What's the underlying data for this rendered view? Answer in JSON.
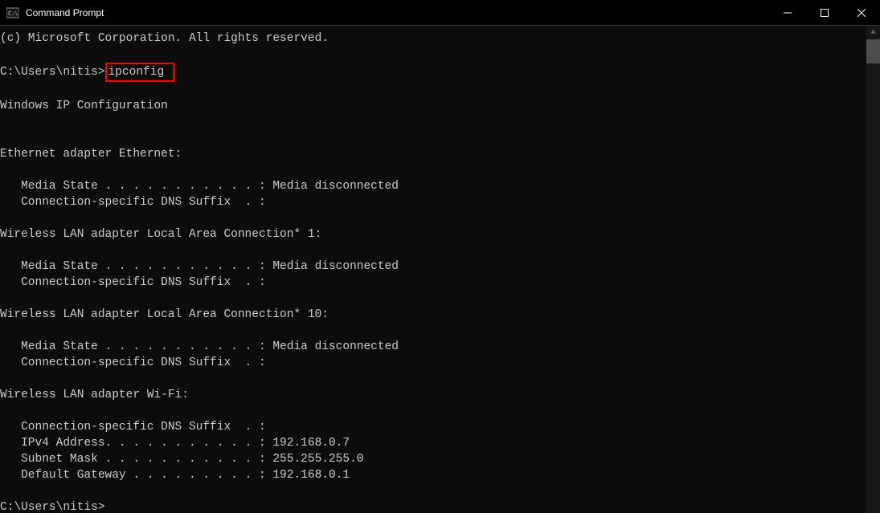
{
  "window": {
    "title": "Command Prompt"
  },
  "terminal": {
    "copyright": "(c) Microsoft Corporation. All rights reserved.",
    "prompt1_path": "C:\\Users\\nitis>",
    "command": "ipconfig",
    "heading": "Windows IP Configuration",
    "adapters": [
      {
        "name": "Ethernet adapter Ethernet:",
        "lines": [
          "   Media State . . . . . . . . . . . : Media disconnected",
          "   Connection-specific DNS Suffix  . :"
        ]
      },
      {
        "name": "Wireless LAN adapter Local Area Connection* 1:",
        "lines": [
          "   Media State . . . . . . . . . . . : Media disconnected",
          "   Connection-specific DNS Suffix  . :"
        ]
      },
      {
        "name": "Wireless LAN adapter Local Area Connection* 10:",
        "lines": [
          "   Media State . . . . . . . . . . . : Media disconnected",
          "   Connection-specific DNS Suffix  . :"
        ]
      },
      {
        "name": "Wireless LAN adapter Wi-Fi:",
        "lines": [
          "   Connection-specific DNS Suffix  . :",
          "   IPv4 Address. . . . . . . . . . . : 192.168.0.7",
          "   Subnet Mask . . . . . . . . . . . : 255.255.255.0",
          "   Default Gateway . . . . . . . . . : 192.168.0.1"
        ]
      }
    ],
    "prompt2": "C:\\Users\\nitis>"
  }
}
